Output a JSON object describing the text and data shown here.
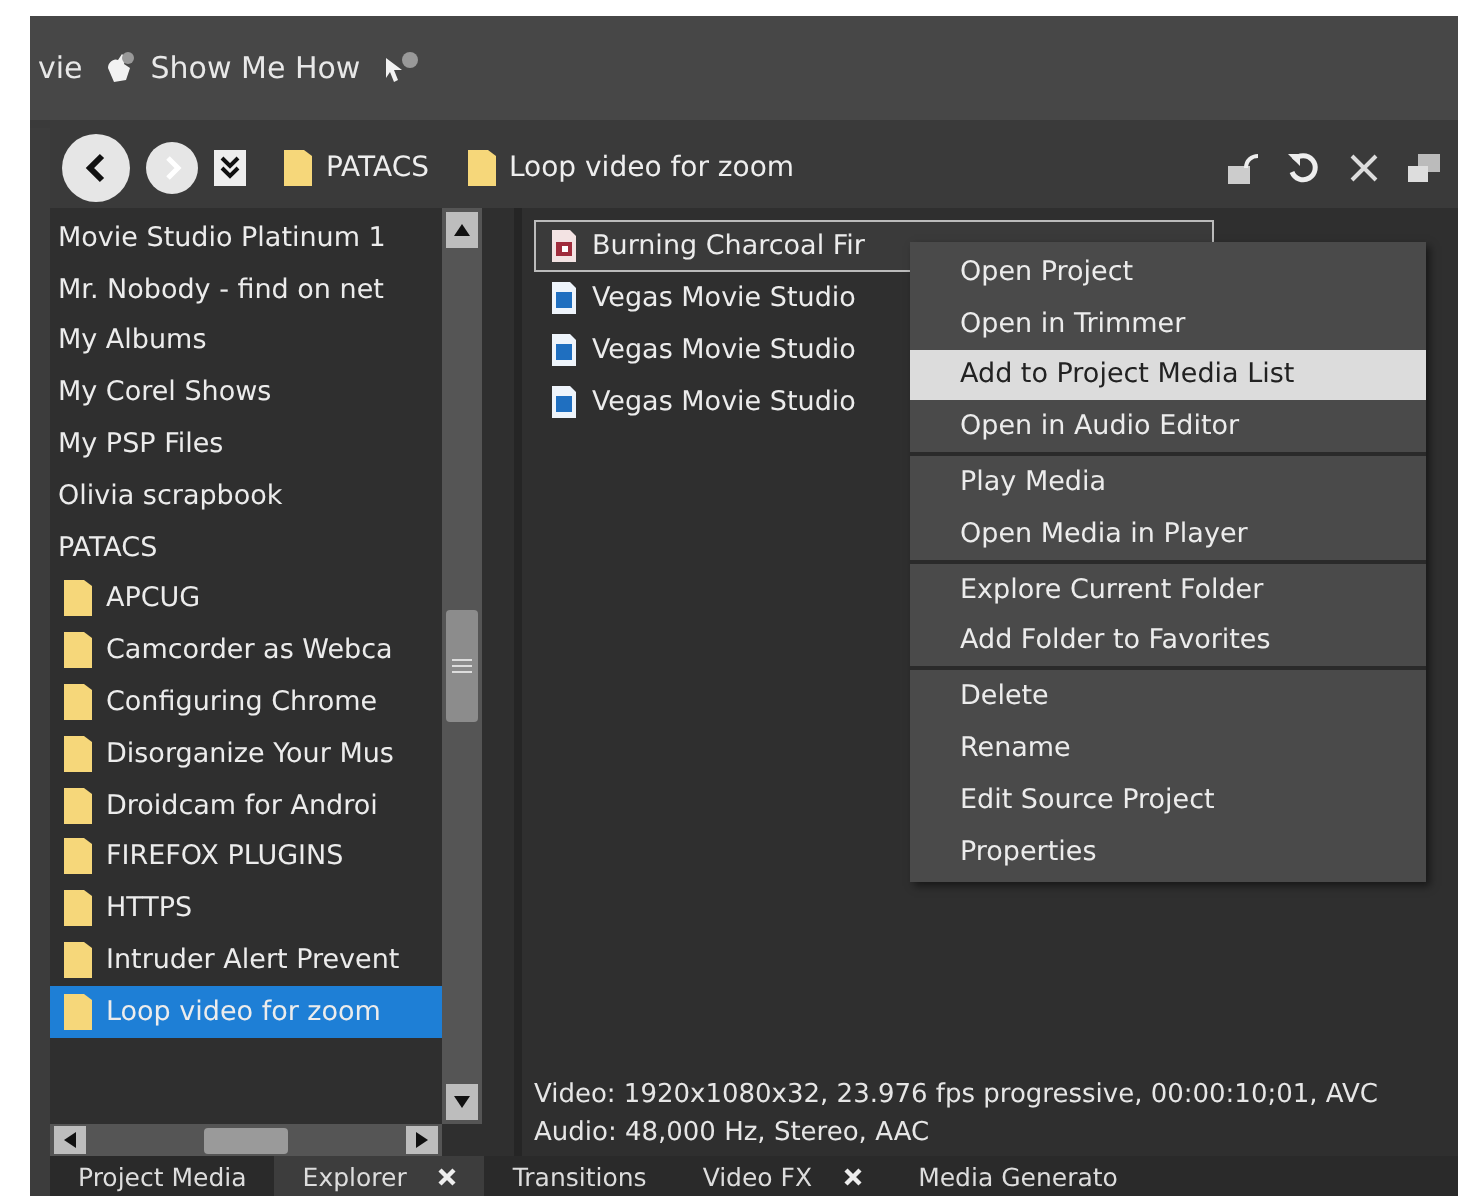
{
  "menu_bar": {
    "items": [
      {
        "label": "vie",
        "kind": "text"
      },
      {
        "label": "Show Me How",
        "kind": "help"
      },
      {
        "kind": "pointer"
      }
    ]
  },
  "toolbar": {
    "breadcrumbs": [
      {
        "label": "PATACS"
      },
      {
        "label": "Loop video for zoom"
      }
    ]
  },
  "tree": {
    "items": [
      {
        "label": "Movie Studio Platinum 1",
        "selected": false
      },
      {
        "label": "Mr. Nobody - find on net",
        "selected": false
      },
      {
        "label": "My Albums",
        "selected": false
      },
      {
        "label": "My Corel Shows",
        "selected": false
      },
      {
        "label": "My PSP Files",
        "selected": false
      },
      {
        "label": "Olivia scrapbook",
        "selected": false
      },
      {
        "label": "PATACS",
        "selected": false,
        "children": [
          {
            "label": "APCUG",
            "selected": false
          },
          {
            "label": "Camcorder as Webca",
            "selected": false
          },
          {
            "label": "Configuring Chrome",
            "selected": false
          },
          {
            "label": "Disorganize Your Mus",
            "selected": false
          },
          {
            "label": "Droidcam for Androi",
            "selected": false
          },
          {
            "label": "FIREFOX PLUGINS",
            "selected": false
          },
          {
            "label": "HTTPS",
            "selected": false
          },
          {
            "label": "Intruder Alert Prevent",
            "selected": false
          },
          {
            "label": "Loop video for zoom",
            "selected": true
          }
        ]
      }
    ]
  },
  "files": [
    {
      "name": "Burning Charcoal Fir",
      "kind": "project",
      "selected": true
    },
    {
      "name": "Vegas Movie Studio",
      "kind": "video",
      "selected": false
    },
    {
      "name": "Vegas Movie Studio",
      "kind": "video",
      "selected": false
    },
    {
      "name": "Vegas Movie Studio",
      "kind": "video",
      "selected": false
    }
  ],
  "context_menu": {
    "groups": [
      [
        {
          "label": "Open Project",
          "selected": false
        },
        {
          "label": "Open in Trimmer",
          "selected": false
        },
        {
          "label": "Add to Project Media List",
          "selected": true
        },
        {
          "label": "Open in Audio Editor",
          "selected": false
        }
      ],
      [
        {
          "label": "Play Media",
          "selected": false
        },
        {
          "label": "Open Media in Player",
          "selected": false
        }
      ],
      [
        {
          "label": "Explore Current Folder",
          "selected": false
        },
        {
          "label": "Add Folder to Favorites",
          "selected": false
        }
      ],
      [
        {
          "label": "Delete",
          "selected": false
        },
        {
          "label": "Rename",
          "selected": false
        },
        {
          "label": "Edit Source Project",
          "selected": false
        },
        {
          "label": "Properties",
          "selected": false
        }
      ]
    ]
  },
  "media_info": [
    "Video: 1920x1080x32, 23.976 fps progressive, 00:00:10;01, AVC",
    "Audio: 48,000 Hz, Stereo, AAC"
  ],
  "tabs": [
    {
      "label": "Project Media",
      "selected": false,
      "closable": false
    },
    {
      "label": "Explorer",
      "selected": true,
      "closable": true
    },
    {
      "label": "Transitions",
      "selected": false,
      "closable": false
    },
    {
      "label": "Video FX",
      "selected": false,
      "closable": true
    },
    {
      "label": "Media Generato",
      "selected": false,
      "closable": false
    }
  ]
}
